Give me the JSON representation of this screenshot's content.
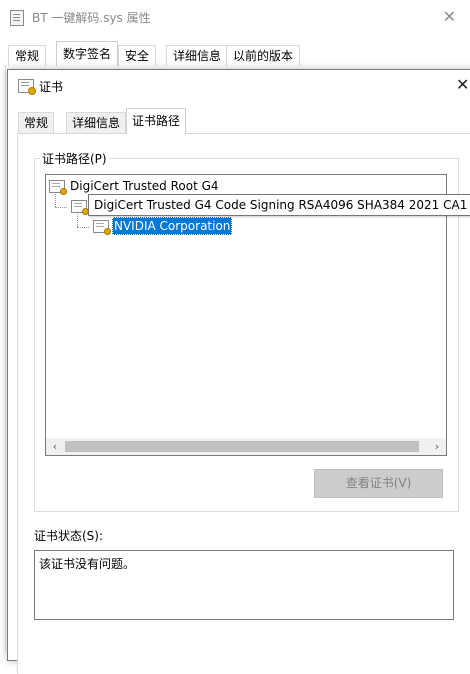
{
  "background_window": {
    "title": "BT 一键解码.sys 属性",
    "tabs": [
      "常规",
      "数字签名",
      "安全",
      "详细信息",
      "以前的版本"
    ],
    "active_tab": "数字签名"
  },
  "dialog": {
    "title": "证书",
    "tabs": [
      "常规",
      "详细信息",
      "证书路径"
    ],
    "active_tab": "证书路径",
    "group_label": "证书路径(P)",
    "tree": [
      {
        "label": "DigiCert Trusted Root G4",
        "level": 0
      },
      {
        "label": "DigiCert Trusted G4 Code Signing RSA4096 SHA384 2021 CA1",
        "level": 1
      },
      {
        "label": "NVIDIA Corporation",
        "level": 2,
        "selected": true
      }
    ],
    "tooltip": "DigiCert Trusted G4 Code Signing RSA4096 SHA384 2021 CA1",
    "view_cert_button": "查看证书(V)",
    "status_label": "证书状态(S):",
    "status_text": "该证书没有问题。"
  },
  "colors": {
    "selection": "#0078d7",
    "disabled_button": "#cccccc",
    "cert_badge": "#e0a800"
  }
}
